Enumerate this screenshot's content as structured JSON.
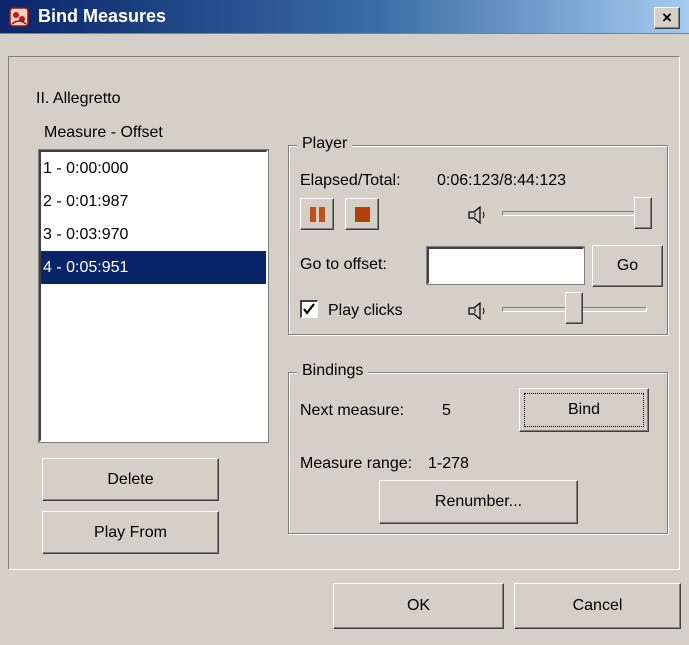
{
  "window": {
    "title": "Bind Measures",
    "close_glyph": "×",
    "icon": "app-icon"
  },
  "movement_title": "II. Allegretto",
  "measure_list": {
    "label": "Measure - Offset",
    "items": [
      {
        "label": "1 - 0:00:000",
        "selected": false
      },
      {
        "label": "2 - 0:01:987",
        "selected": false
      },
      {
        "label": "3 - 0:03:970",
        "selected": false
      },
      {
        "label": "4 - 0:05:951",
        "selected": true
      }
    ]
  },
  "left_buttons": {
    "delete": "Delete",
    "play_from": "Play From"
  },
  "player": {
    "group_label": "Player",
    "elapsed_label": "Elapsed/Total:",
    "elapsed_value": "0:06:123/8:44:123",
    "pause_icon": "pause-icon",
    "stop_icon": "stop-icon",
    "volume_level": 1.0,
    "go_to_offset_label": "Go to offset:",
    "offset_value": "",
    "go_button": "Go",
    "play_clicks_label": "Play clicks",
    "play_clicks_checked": true,
    "clicks_volume_level": 0.5
  },
  "bindings": {
    "group_label": "Bindings",
    "next_measure_label": "Next measure:",
    "next_measure_value": "5",
    "bind_button": "Bind",
    "measure_range_label": "Measure range:",
    "measure_range_value": "1-278",
    "renumber_button": "Renumber..."
  },
  "footer": {
    "ok": "OK",
    "cancel": "Cancel"
  },
  "colors": {
    "dialog_bg": "#d4d0c8",
    "title_start": "#0a246a",
    "title_end": "#a6caf0",
    "selection": "#0a246a",
    "media_button_icon": "#c0501a"
  }
}
